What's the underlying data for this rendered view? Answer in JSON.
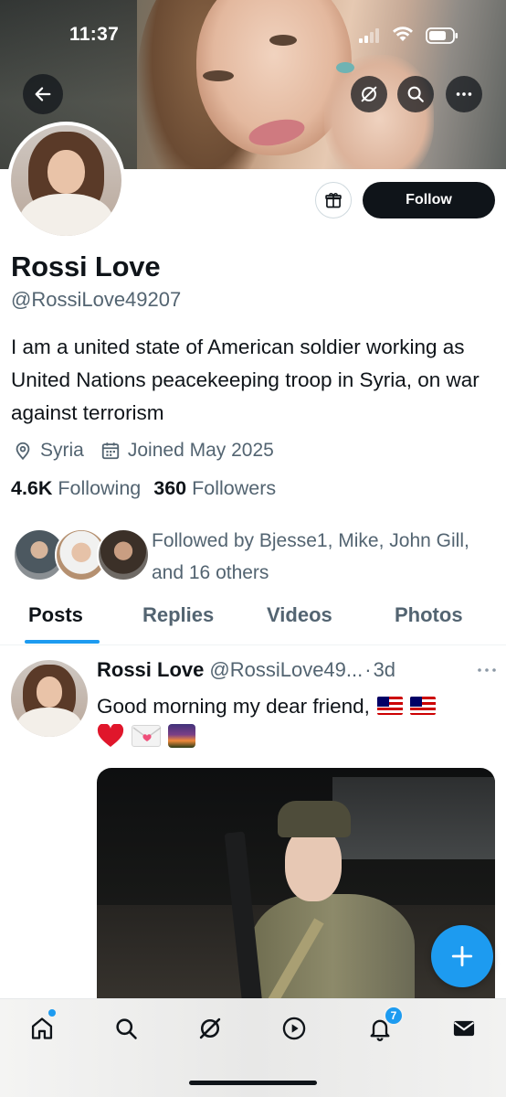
{
  "status_bar": {
    "time": "11:37"
  },
  "profile": {
    "display_name": "Rossi Love",
    "handle": "@RossiLove49207",
    "bio": "I am a united state of American soldier working as United Nations peacekeeping troop in Syria, on war against terrorism",
    "location": "Syria",
    "joined": "Joined May 2025",
    "following_count": "4.6K",
    "following_label": "Following",
    "followers_count": "360",
    "followers_label": "Followers",
    "followed_by": "Followed by Bjesse1, Mike, John Gill, and 16 others",
    "follow_label": "Follow"
  },
  "tabs": [
    {
      "label": "Posts",
      "active": true
    },
    {
      "label": "Replies",
      "active": false
    },
    {
      "label": "Videos",
      "active": false
    },
    {
      "label": "Photos",
      "active": false
    }
  ],
  "post": {
    "author_name": "Rossi Love",
    "author_handle": "@RossiLove49...",
    "separator": "·",
    "time": "3d",
    "text": "Good morning my dear friend,"
  },
  "nav": {
    "items": [
      "home-icon",
      "search-icon",
      "grok-icon",
      "video-icon",
      "notifications-icon",
      "messages-icon"
    ],
    "notification_badge": "7"
  },
  "colors": {
    "accent": "#1d9bf0",
    "text_primary": "#0f1419",
    "text_secondary": "#536471"
  }
}
